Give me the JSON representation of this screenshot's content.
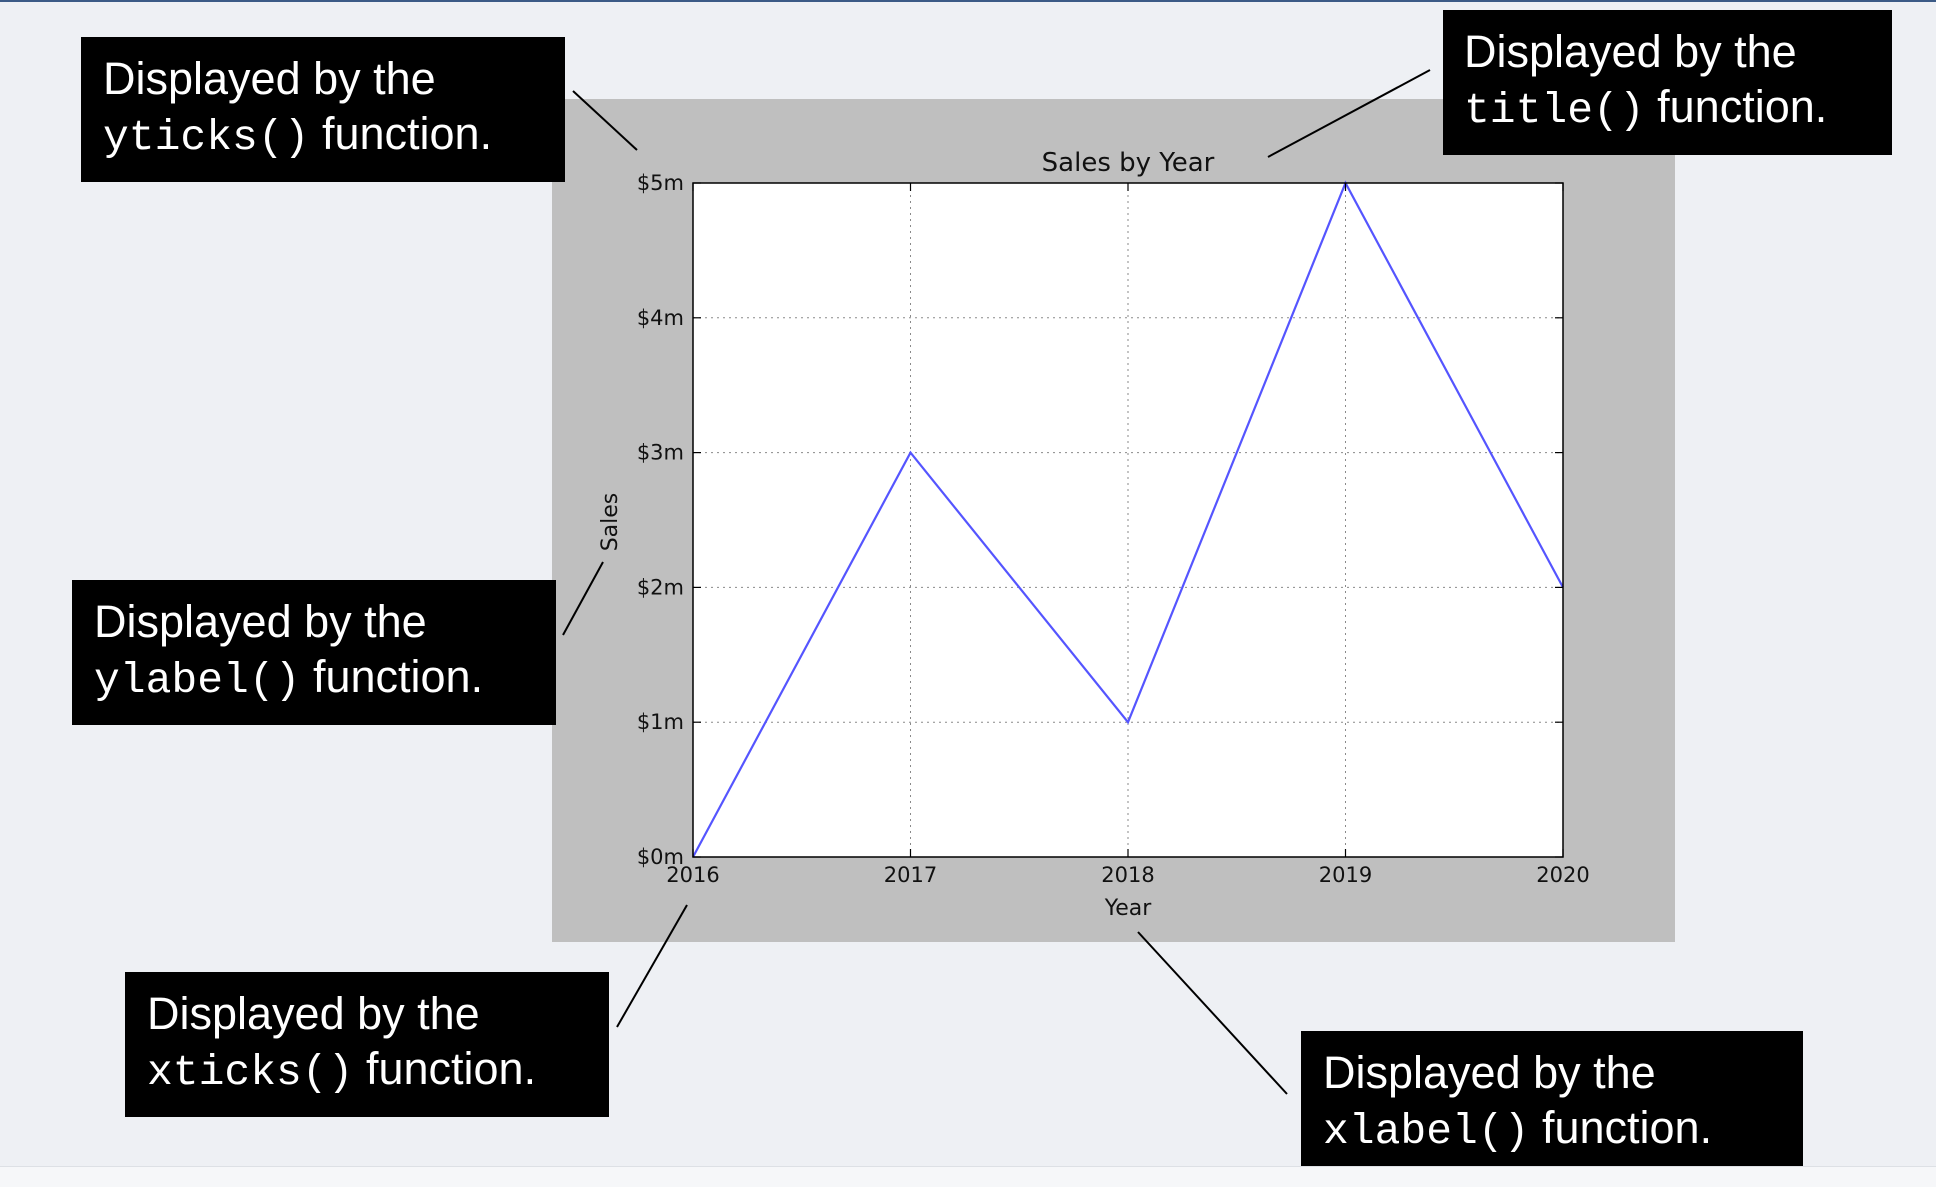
{
  "callouts": {
    "yticks": {
      "line1": "Displayed by the",
      "code": "yticks()",
      "tail": "function."
    },
    "title": {
      "line1": "Displayed by the",
      "code": "title()",
      "tail": "function."
    },
    "ylabel": {
      "line1": "Displayed by the",
      "code": "ylabel()",
      "tail": "function."
    },
    "xticks": {
      "line1": "Displayed by the",
      "code": "xticks()",
      "tail": "function."
    },
    "xlabel": {
      "line1": "Displayed by the",
      "code": "xlabel()",
      "tail": "function."
    }
  },
  "chart_data": {
    "type": "line",
    "title": "Sales by Year",
    "xlabel": "Year",
    "ylabel": "Sales",
    "x": [
      2016,
      2017,
      2018,
      2019,
      2020
    ],
    "values": [
      0,
      3,
      1,
      5,
      2
    ],
    "xticks": [
      "2016",
      "2017",
      "2018",
      "2019",
      "2020"
    ],
    "yticks": [
      0,
      1,
      2,
      3,
      4,
      5
    ],
    "ytick_labels": [
      "$0m",
      "$1m",
      "$2m",
      "$3m",
      "$4m",
      "$5m"
    ],
    "xlim": [
      2016,
      2020
    ],
    "ylim": [
      0,
      5
    ],
    "grid": true,
    "line_color": "#5555ff",
    "figure_background": "#bfbfbf",
    "plot_background": "#ffffff"
  }
}
